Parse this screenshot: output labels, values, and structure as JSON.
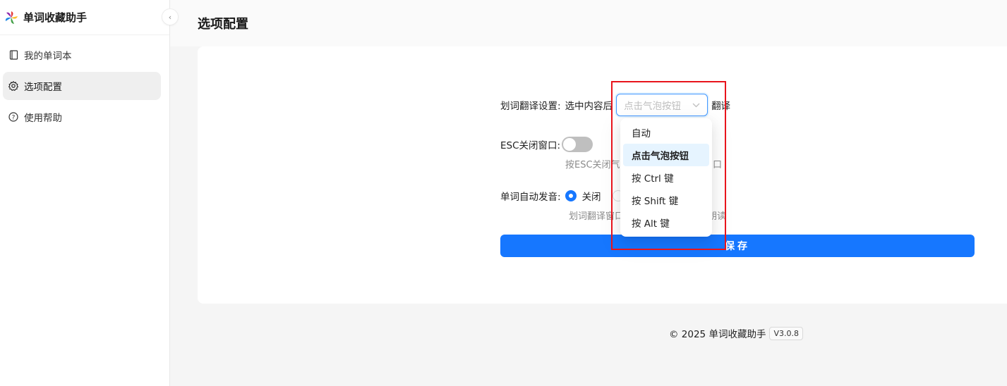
{
  "app": {
    "title": "单词收藏助手"
  },
  "sidebar": {
    "items": [
      {
        "label": "我的单词本",
        "icon": "book-icon",
        "active": false
      },
      {
        "label": "选项配置",
        "icon": "gear-icon",
        "active": true
      },
      {
        "label": "使用帮助",
        "icon": "help-circle-icon",
        "active": false
      }
    ]
  },
  "page": {
    "title": "选项配置"
  },
  "settings": {
    "translate": {
      "label": "划词翻译设置:",
      "prefix": "选中内容后",
      "selected": "点击气泡按钮",
      "suffix": "翻译",
      "options": [
        "自动",
        "点击气泡按钮",
        "按 Ctrl 键",
        "按 Shift 键",
        "按 Alt 键"
      ]
    },
    "esc": {
      "label": "ESC关闭窗口:",
      "hint_left": "按ESC关闭气",
      "hint_right": "口",
      "enabled": false
    },
    "auto_pronounce": {
      "label": "单词自动发音:",
      "option_off": "关闭",
      "hint_left": "划词翻译窗口",
      "hint_right": "朗读"
    },
    "save_label": "保存"
  },
  "footer": {
    "copyright": "© 2025 单词收藏助手",
    "version": "V3.0.8"
  },
  "colors": {
    "primary": "#1677ff",
    "highlight": "#e8141c"
  }
}
